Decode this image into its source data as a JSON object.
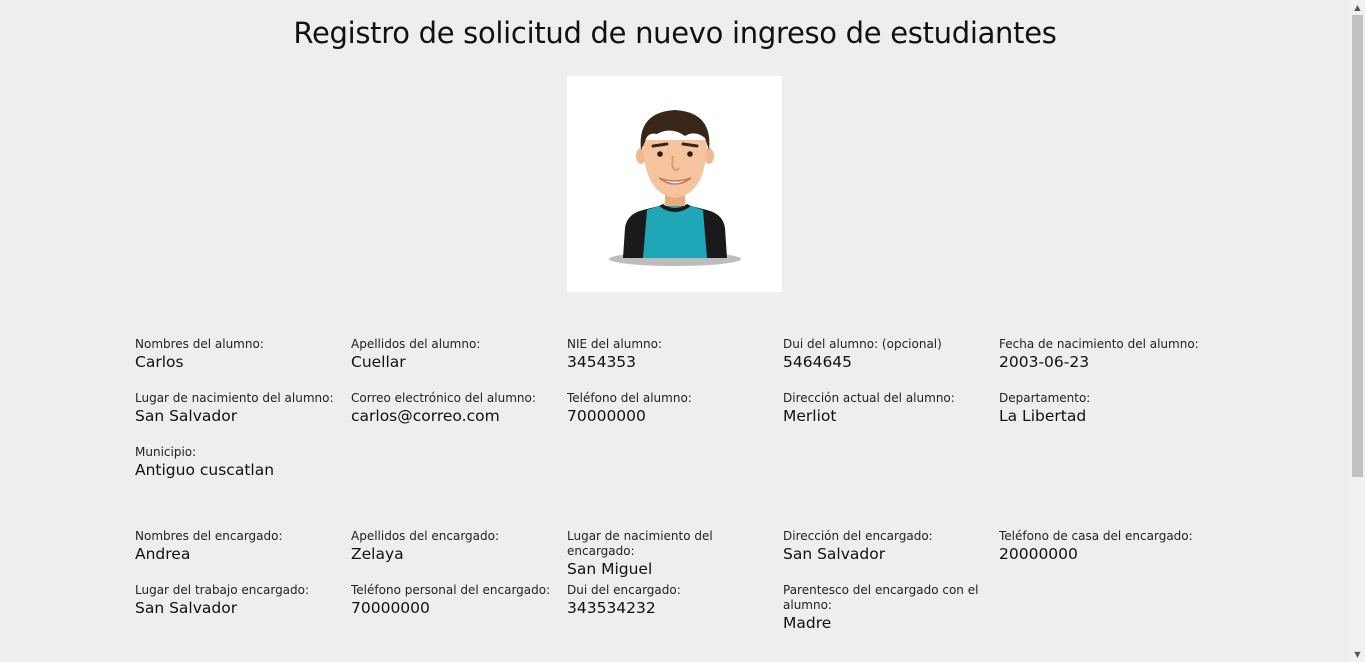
{
  "page": {
    "title": "Registro de solicitud de nuevo ingreso de estudiantes"
  },
  "student_fields": [
    {
      "label": "Nombres del alumno:",
      "value": "Carlos"
    },
    {
      "label": "Apellidos del alumno:",
      "value": "Cuellar"
    },
    {
      "label": "NIE del alumno:",
      "value": "3454353"
    },
    {
      "label": "Dui del alumno: (opcional)",
      "value": "5464645"
    },
    {
      "label": "Fecha de nacimiento del alumno:",
      "value": "2003-06-23"
    },
    {
      "label": "Lugar de nacimiento del alumno:",
      "value": "San Salvador"
    },
    {
      "label": "Correo electrónico del alumno:",
      "value": "carlos@correo.com"
    },
    {
      "label": "Teléfono del alumno:",
      "value": "70000000"
    },
    {
      "label": "Dirección actual del alumno:",
      "value": "Merliot"
    },
    {
      "label": "Departamento:",
      "value": "La Libertad"
    },
    {
      "label": "Municipio:",
      "value": "Antiguo cuscatlan"
    }
  ],
  "guardian_fields": [
    {
      "label": "Nombres del encargado:",
      "value": "Andrea"
    },
    {
      "label": "Apellidos del encargado:",
      "value": "Zelaya"
    },
    {
      "label": "Lugar de nacimiento del encargado:",
      "value": "San Miguel"
    },
    {
      "label": "Dirección del encargado:",
      "value": "San Salvador"
    },
    {
      "label": "Teléfono de casa del encargado:",
      "value": "20000000"
    },
    {
      "label": "Lugar del trabajo encargado:",
      "value": "San Salvador"
    },
    {
      "label": "Teléfono personal del encargado:",
      "value": "70000000"
    },
    {
      "label": "Dui del encargado:",
      "value": "343534232"
    },
    {
      "label": "Parentesco del encargado con el alumno:",
      "value": "Madre"
    }
  ],
  "icons": {
    "photo": "student-avatar-icon",
    "scroll_up": "scroll-up-arrow-icon",
    "scroll_down": "scroll-down-arrow-icon"
  },
  "colors": {
    "background": "#eeeeee",
    "shirt": "#1fa7b7"
  }
}
